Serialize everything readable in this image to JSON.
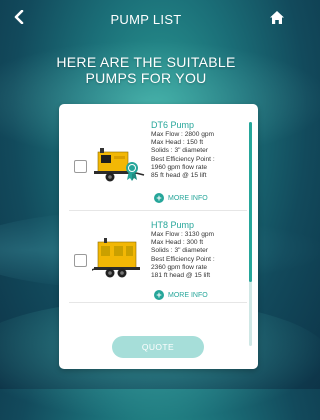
{
  "header": {
    "title": "PUMP LIST",
    "back_icon": "chevron-left-icon",
    "home_icon": "home-icon"
  },
  "headline": {
    "line1": "HERE ARE THE SUITABLE",
    "line2": "PUMPS FOR YOU"
  },
  "pumps": [
    {
      "name": "DT6 Pump",
      "specs": [
        "Max Flow : 2800 gpm",
        "Max Head : 150 ft",
        "Solids : 3\" diameter",
        "Best Efficiency Point :",
        "1960 gpm flow rate",
        "85 ft head @ 15 lift"
      ],
      "more_info": "MORE INFO"
    },
    {
      "name": "HT8 Pump",
      "specs": [
        "Max Flow : 3130 gpm",
        "Max Head : 300 ft",
        "Solids : 3\" diameter",
        "Best Efficiency Point :",
        "2360 gpm flow rate",
        "181 ft head @ 15 lift"
      ],
      "more_info": "MORE INFO"
    }
  ],
  "quote_button": "QUOTE",
  "colors": {
    "accent": "#26a69a",
    "pump_yellow": "#f2b705",
    "quote_bg": "#a6ded9"
  }
}
